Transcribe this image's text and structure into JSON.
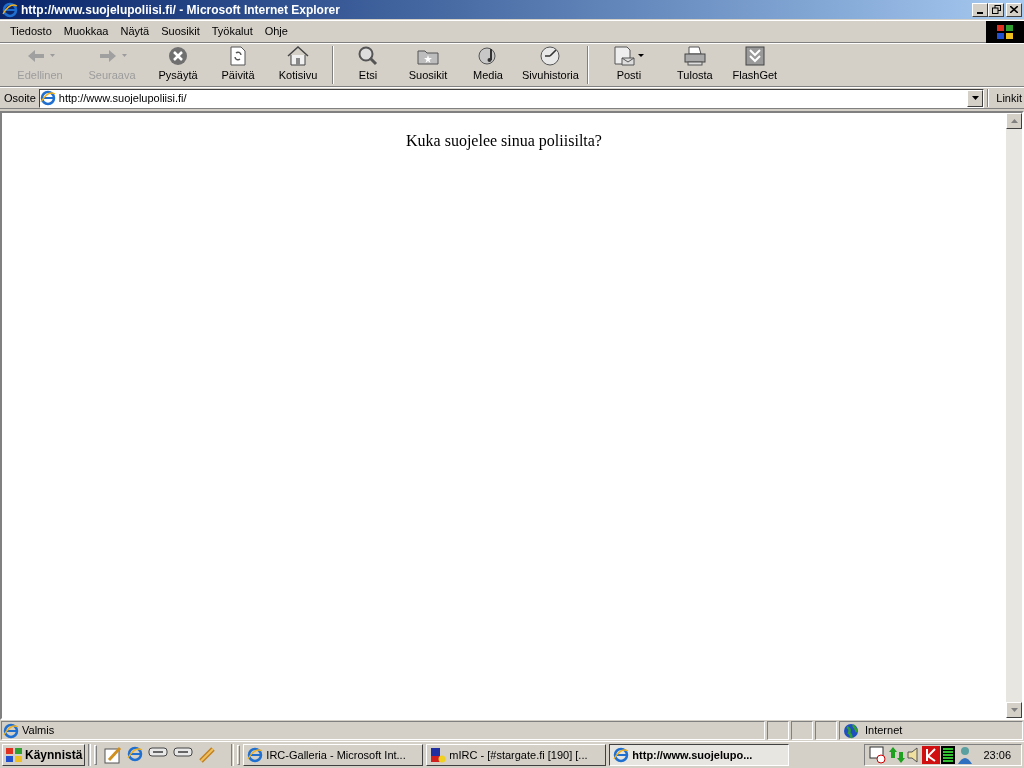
{
  "window": {
    "title": "http://www.suojelupoliisi.fi/ - Microsoft Internet Explorer"
  },
  "menu": [
    "Tiedosto",
    "Muokkaa",
    "Näytä",
    "Suosikit",
    "Työkalut",
    "Ohje"
  ],
  "toolbar": [
    [
      {
        "label": "Edellinen",
        "kind": "back",
        "disabled": true,
        "dropdown": true
      },
      {
        "label": "Seuraava",
        "kind": "forward",
        "disabled": true,
        "dropdown": true
      },
      {
        "label": "Pysäytä",
        "kind": "stop",
        "disabled": false,
        "dropdown": false
      },
      {
        "label": "Päivitä",
        "kind": "refresh",
        "disabled": false,
        "dropdown": false
      },
      {
        "label": "Kotisivu",
        "kind": "home",
        "disabled": false,
        "dropdown": false
      }
    ],
    [
      {
        "label": "Etsi",
        "kind": "search",
        "disabled": false,
        "dropdown": false
      },
      {
        "label": "Suosikit",
        "kind": "favorites",
        "disabled": false,
        "dropdown": false
      },
      {
        "label": "Media",
        "kind": "media",
        "disabled": false,
        "dropdown": false
      },
      {
        "label": "Sivuhistoria",
        "kind": "history",
        "disabled": false,
        "dropdown": false
      }
    ],
    [
      {
        "label": "Posti",
        "kind": "mail",
        "disabled": false,
        "dropdown": true
      },
      {
        "label": "Tulosta",
        "kind": "print",
        "disabled": false,
        "dropdown": false
      },
      {
        "label": "FlashGet",
        "kind": "flashget",
        "disabled": false,
        "dropdown": false
      }
    ]
  ],
  "address_bar": {
    "label": "Osoite",
    "value": "http://www.suojelupoliisi.fi/",
    "links": "Linkit"
  },
  "page": {
    "text": "Kuka suojelee sinua poliisilta?"
  },
  "status_bar": {
    "text": "Valmis",
    "zone": "Internet"
  },
  "taskbar": {
    "start": "Käynnistä",
    "quick_launch": [
      {
        "kind": "pencil"
      },
      {
        "kind": "ie"
      },
      {
        "kind": "drive"
      },
      {
        "kind": "drive"
      },
      {
        "kind": "tool"
      }
    ],
    "tasks": [
      {
        "label": "IRC-Galleria - Microsoft Int...",
        "kind": "ie",
        "selected": false
      },
      {
        "label": "mIRC - [#stargate.fi [190] [...",
        "kind": "mirc",
        "selected": false
      },
      {
        "label": "http://www.suojelupo...",
        "kind": "ie",
        "selected": true
      }
    ],
    "tray": [
      {
        "kind": "scheduler"
      },
      {
        "kind": "network"
      },
      {
        "kind": "volume"
      },
      {
        "kind": "antivirus"
      },
      {
        "kind": "meter"
      },
      {
        "kind": "user"
      }
    ],
    "clock": "23:06"
  }
}
